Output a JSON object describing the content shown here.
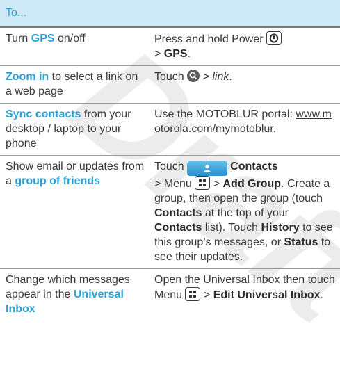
{
  "watermark": "Draft",
  "header": {
    "col1": "To..."
  },
  "rows": [
    {
      "todo": {
        "pre": "Turn ",
        "hl": "GPS",
        "post": " on/off"
      },
      "how": {
        "t1": "Press and hold Power ",
        "t2": "> ",
        "gps": "GPS",
        "t3": "."
      }
    },
    {
      "todo": {
        "hl": "Zoom in",
        "post": " to select a link on a web page"
      },
      "how": {
        "t1": "Touch ",
        "t2": " > ",
        "link": "link",
        "t3": "."
      }
    },
    {
      "todo": {
        "hl": "Sync contacts",
        "post": " from your desktop / laptop to your phone"
      },
      "how": {
        "t1": "Use the MOTOBLUR portal: ",
        "url": "www.motorola.com/mymotoblur",
        "t2": "."
      }
    },
    {
      "todo": {
        "pre": "Show email or updates from a ",
        "hl": "group of friends"
      },
      "how": {
        "t1": "Touch ",
        "contacts": "Contacts",
        "t2": "> Menu ",
        "t3": " > ",
        "add_group": "Add Group",
        "t4": ". Create a group, then open the group (touch ",
        "contacts2": "Contacts",
        "t5": " at the top of your ",
        "contacts3": "Contacts",
        "t6": " list). Touch ",
        "history": "History",
        "t7": " to see this group’s messages, or ",
        "status": "Status",
        "t8": " to see their updates."
      }
    },
    {
      "todo": {
        "pre": "Change which messages appear in the ",
        "hl": "Universal Inbox"
      },
      "how": {
        "t1": "Open the Universal Inbox then touch Menu ",
        "t2": " > ",
        "edit": "Edit Universal Inbox",
        "t3": "."
      }
    }
  ],
  "icons": {
    "power": "power-icon",
    "zoom": "zoom-icon",
    "contacts": "person-icon",
    "menu": "menu-icon"
  },
  "colors": {
    "accent": "#2aa2d8",
    "header_bg": "#cfeaf7"
  }
}
